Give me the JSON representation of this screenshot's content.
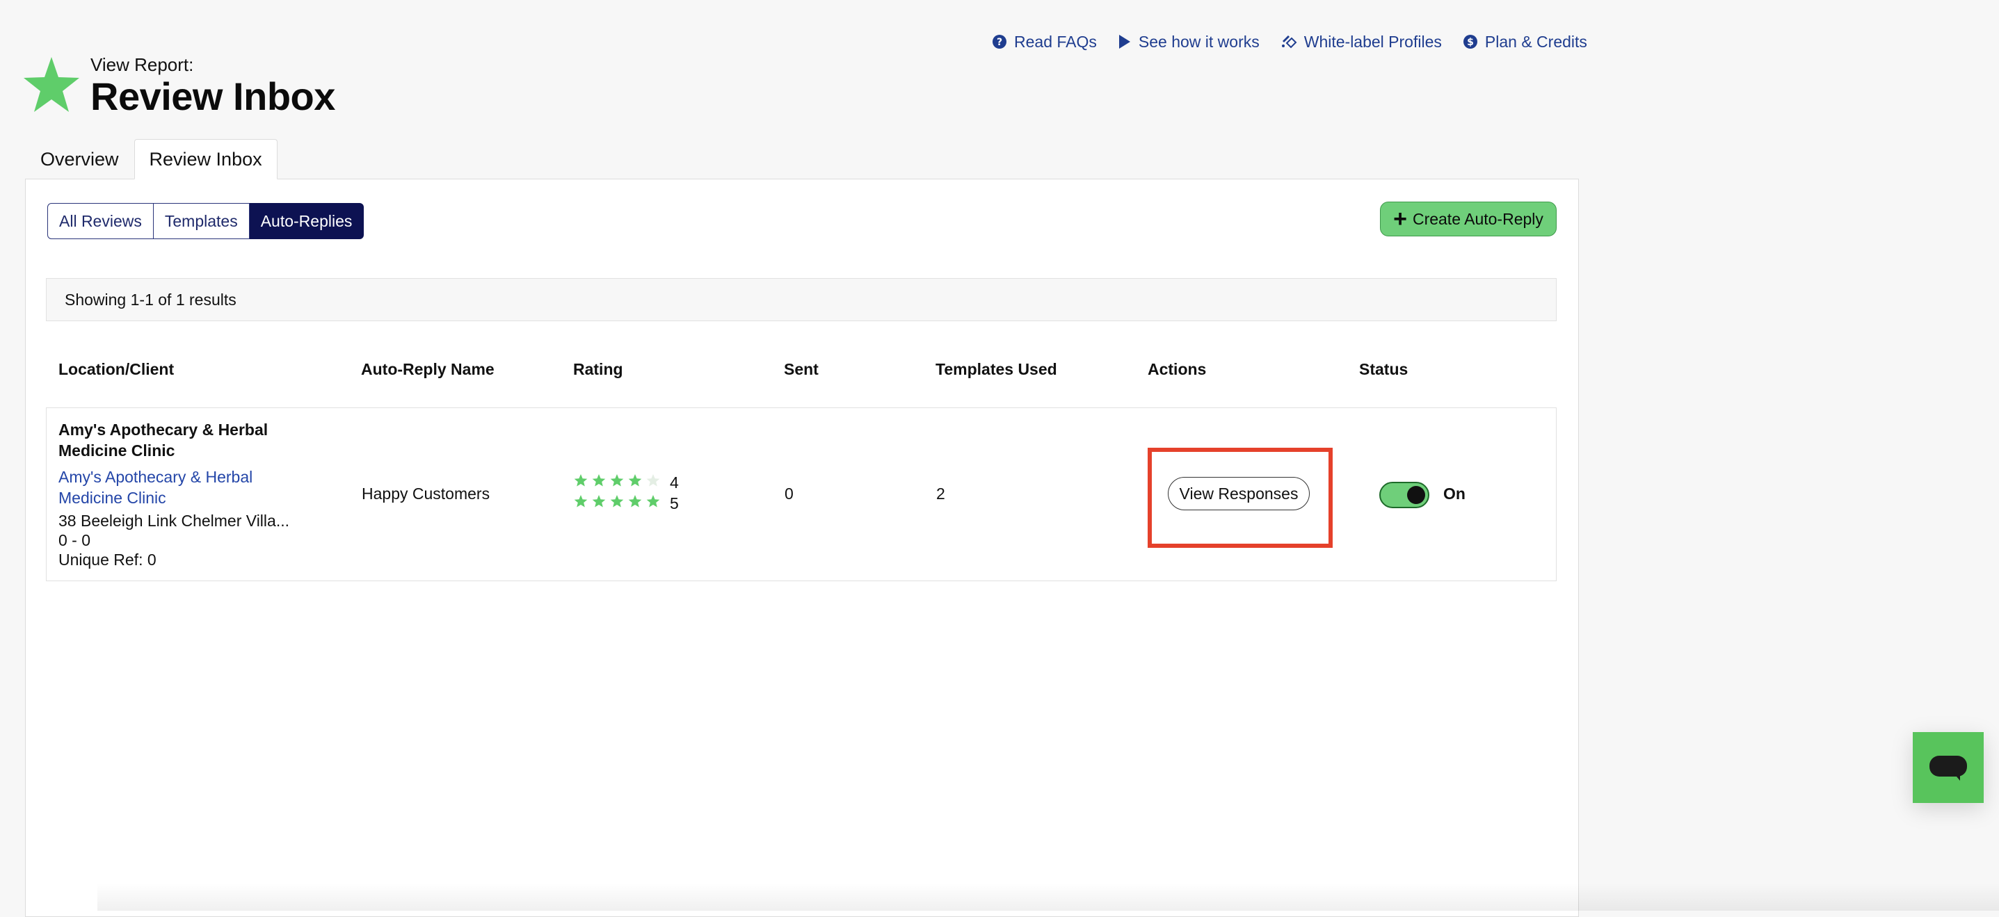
{
  "top_links": [
    {
      "label": "Read FAQs",
      "icon": "question-circle-icon"
    },
    {
      "label": "See how it works",
      "icon": "play-icon"
    },
    {
      "label": "White-label Profiles",
      "icon": "paint-tag-icon"
    },
    {
      "label": "Plan & Credits",
      "icon": "dollar-circle-icon"
    }
  ],
  "header": {
    "subtitle": "View Report:",
    "title": "Review Inbox",
    "logo_icon": "star-icon",
    "logo_color": "#5fcd6a"
  },
  "tabs": [
    {
      "label": "Overview",
      "active": false
    },
    {
      "label": "Review Inbox",
      "active": true
    }
  ],
  "segments": [
    {
      "label": "All Reviews",
      "active": false
    },
    {
      "label": "Templates",
      "active": false
    },
    {
      "label": "Auto-Replies",
      "active": true
    }
  ],
  "create_button": {
    "label": "Create Auto-Reply",
    "icon": "plus-icon"
  },
  "results": {
    "text": "Showing 1-1 of 1 results"
  },
  "table": {
    "columns": [
      "Location/Client",
      "Auto-Reply Name",
      "Rating",
      "Sent",
      "Templates Used",
      "Actions",
      "Status"
    ],
    "rows": [
      {
        "location_name": "Amy's Apothecary & Herbal Medicine Clinic",
        "location_link": "Amy's Apothecary & Herbal Medicine Clinic",
        "address": "38 Beeleigh Link Chelmer Villa...",
        "range": "0 - 0",
        "unique_ref": "Unique Ref: 0",
        "auto_reply_name": "Happy Customers",
        "ratings": [
          {
            "stars": 4,
            "label": "4"
          },
          {
            "stars": 5,
            "label": "5"
          }
        ],
        "sent": "0",
        "templates_used": "2",
        "action_label": "View Responses",
        "status_on": true,
        "status_label": "On"
      }
    ]
  },
  "colors": {
    "accent_green": "#6fcf7a",
    "navy": "#0d1252",
    "link_blue": "#2446a8",
    "highlight_red": "#e5412b"
  },
  "chat_widget": {
    "icon": "chat-bubble-icon"
  }
}
